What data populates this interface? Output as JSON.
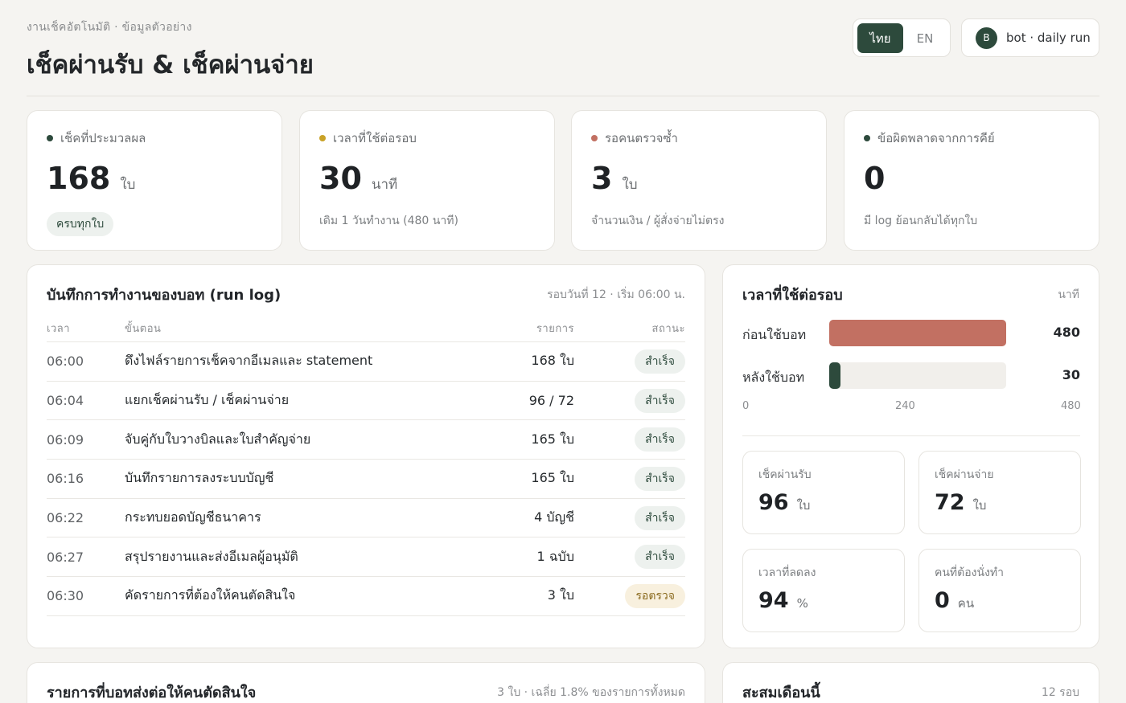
{
  "header": {
    "eyebrow": "งานเช็คอัตโนมัติ · ข้อมูลตัวอย่าง",
    "title": "เช็คผ่านรับ & เช็คผ่านจ่าย",
    "lang_th": "ไทย",
    "lang_en": "EN",
    "avatar_initial": "B",
    "user": "bot · daily run"
  },
  "kpis": [
    {
      "label": "เช็คที่ประมวลผล",
      "value": "168",
      "unit": "ใบ",
      "pill": "ครบทุกใบ",
      "dot_color": "#2d4a3c"
    },
    {
      "label": "เวลาที่ใช้ต่อรอบ",
      "value": "30",
      "unit": "นาที",
      "sub": "เดิม 1 วันทำงาน (480 นาที)",
      "dot_color": "#c9a227"
    },
    {
      "label": "รอคนตรวจซ้ำ",
      "value": "3",
      "unit": "ใบ",
      "sub": "จำนวนเงิน / ผู้สั่งจ่ายไม่ตรง",
      "dot_color": "#c27062"
    },
    {
      "label": "ข้อผิดพลาดจากการคีย์",
      "value": "0",
      "unit": "",
      "sub": "มี log ย้อนกลับได้ทุกใบ",
      "dot_color": "#2d4a3c"
    }
  ],
  "run_log": {
    "title": "บันทึกการทำงานของบอท (run log)",
    "meta": "รอบวันที่ 12 · เริ่ม 06:00 น.",
    "headers": {
      "time": "เวลา",
      "step": "ขั้นตอน",
      "count": "รายการ",
      "status": "สถานะ"
    },
    "rows": [
      {
        "time": "06:00",
        "step": "ดึงไฟล์รายการเช็คจากอีเมลและ statement",
        "count": "168 ใบ",
        "status": "สำเร็จ"
      },
      {
        "time": "06:04",
        "step": "แยกเช็คผ่านรับ / เช็คผ่านจ่าย",
        "count": "96 / 72",
        "status": "สำเร็จ"
      },
      {
        "time": "06:09",
        "step": "จับคู่กับใบวางบิลและใบสำคัญจ่าย",
        "count": "165 ใบ",
        "status": "สำเร็จ"
      },
      {
        "time": "06:16",
        "step": "บันทึกรายการลงระบบบัญชี",
        "count": "165 ใบ",
        "status": "สำเร็จ"
      },
      {
        "time": "06:22",
        "step": "กระทบยอดบัญชีธนาคาร",
        "count": "4 บัญชี",
        "status": "สำเร็จ"
      },
      {
        "time": "06:27",
        "step": "สรุปรายงานและส่งอีเมลผู้อนุมัติ",
        "count": "1 ฉบับ",
        "status": "สำเร็จ"
      },
      {
        "time": "06:30",
        "step": "คัดรายการที่ต้องให้คนตัดสินใจ",
        "count": "3 ใบ",
        "status": "รอตรวจ"
      }
    ]
  },
  "time_panel": {
    "title": "เวลาที่ใช้ต่อรอบ",
    "unit": "นาที",
    "chart_data": {
      "type": "bar",
      "orientation": "horizontal",
      "categories": [
        "ก่อนใช้บอท",
        "หลังใช้บอท"
      ],
      "values": [
        480,
        30
      ],
      "xlim": [
        0,
        480
      ],
      "ticks": [
        "0",
        "240",
        "480"
      ],
      "colors": [
        "#c27062",
        "#2d4a3c"
      ]
    },
    "stats": [
      {
        "label": "เช็คผ่านรับ",
        "value": "96",
        "unit": "ใบ"
      },
      {
        "label": "เช็คผ่านจ่าย",
        "value": "72",
        "unit": "ใบ"
      },
      {
        "label": "เวลาที่ลดลง",
        "value": "94",
        "unit": "%"
      },
      {
        "label": "คนที่ต้องนั่งทำ",
        "value": "0",
        "unit": "คน"
      }
    ]
  },
  "handoff": {
    "title": "รายการที่บอทส่งต่อให้คนตัดสินใจ",
    "meta": "3 ใบ · เฉลี่ย 1.8% ของรายการทั้งหมด"
  },
  "monthly": {
    "title": "สะสมเดือนนี้",
    "meta": "12 รอบ"
  }
}
